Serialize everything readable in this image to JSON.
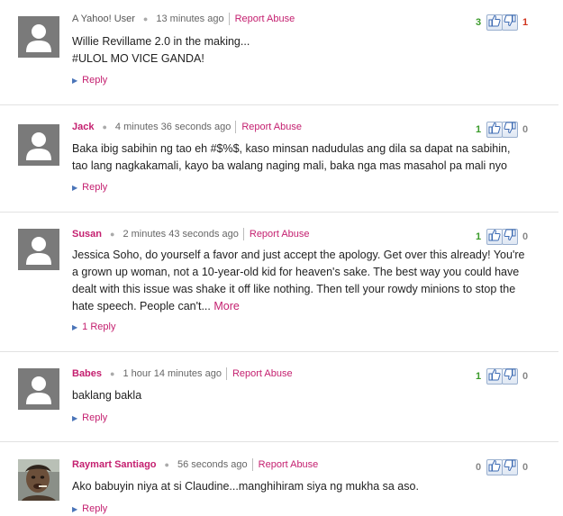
{
  "comments": [
    {
      "author": "A Yahoo! User",
      "anonymous": true,
      "time": "13 minutes ago",
      "report_label": "Report Abuse",
      "lines": [
        "Willie Revillame 2.0 in the making...",
        "#ULOL MO VICE GANDA!"
      ],
      "more": "",
      "reply_label": "Reply",
      "thumbs_up": "3",
      "thumbs_down": "1",
      "avatar": "default-avatar"
    },
    {
      "author": "Jack",
      "anonymous": false,
      "time": "4 minutes 36 seconds ago",
      "report_label": "Report Abuse",
      "lines": [
        "Baka ibig sabihin ng tao eh #$%$, kaso minsan nadudulas ang dila sa dapat na sabihin,",
        "tao lang nagkakamali, kayo ba walang naging mali, baka nga mas masahol pa mali nyo"
      ],
      "more": "",
      "reply_label": "Reply",
      "thumbs_up": "1",
      "thumbs_down": "0",
      "avatar": "default-avatar"
    },
    {
      "author": "Susan",
      "anonymous": false,
      "time": "2 minutes 43 seconds ago",
      "report_label": "Report Abuse",
      "lines": [
        "Jessica Soho, do yourself a favor and just accept the apology. Get over this already! You're",
        "a grown up woman, not a 10-year-old kid for heaven's sake. The best way you could have",
        "dealt with this issue was shake it off like nothing. Then tell your rowdy minions to stop the",
        "hate speech. People can't... "
      ],
      "more": "More",
      "reply_label": "1 Reply",
      "thumbs_up": "1",
      "thumbs_down": "0",
      "avatar": "default-avatar"
    },
    {
      "author": "Babes",
      "anonymous": false,
      "time": "1 hour 14 minutes ago",
      "report_label": "Report Abuse",
      "lines": [
        "baklang bakla"
      ],
      "more": "",
      "reply_label": "Reply",
      "thumbs_up": "1",
      "thumbs_down": "0",
      "avatar": "default-avatar"
    },
    {
      "author": "Raymart Santiago",
      "anonymous": false,
      "time": "56 seconds ago",
      "report_label": "Report Abuse",
      "lines": [
        "Ako babuyin niya at si Claudine...manghihiram siya ng mukha sa aso."
      ],
      "more": "",
      "reply_label": "Reply",
      "thumbs_up": "0",
      "thumbs_down": "0",
      "avatar": "user-photo"
    }
  ],
  "colors": {
    "accent": "#c41f6f",
    "thumbs_up_count": "#3a9a2a",
    "thumbs_down_count": "#d0341d",
    "divider": "#e2e2e2"
  },
  "icons": {
    "reply": "triangle-right-icon",
    "thumbs_up": "thumbs-up-icon",
    "thumbs_down": "thumbs-down-icon"
  }
}
